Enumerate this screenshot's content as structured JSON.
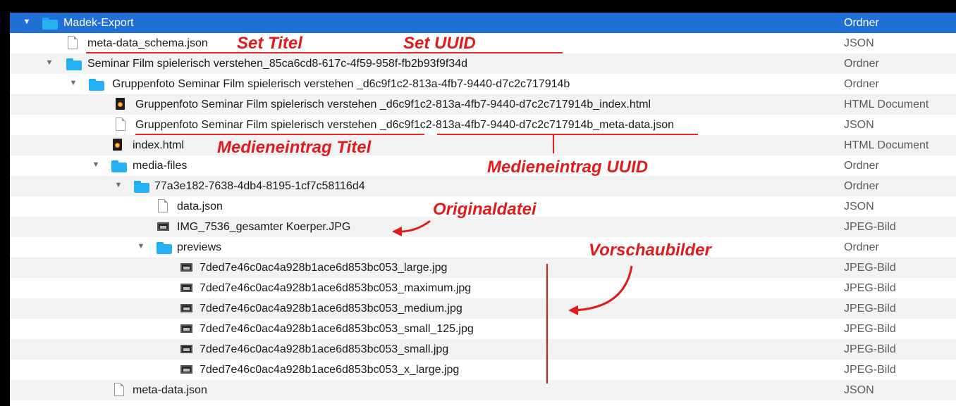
{
  "rows": [
    {
      "name": "Madek-Export",
      "kind": "Ordner",
      "icon": "folder-icon"
    },
    {
      "name": "meta-data_schema.json",
      "kind": "JSON",
      "icon": "document-icon"
    },
    {
      "name": "Seminar Film spielerisch verstehen_85ca6cd8-617c-4f59-958f-fb2b93f9f34d",
      "kind": "Ordner",
      "icon": "folder-icon"
    },
    {
      "name": "Gruppenfoto Seminar Film spielerisch verstehen _d6c9f1c2-813a-4fb7-9440-d7c2c717914b",
      "kind": "Ordner",
      "icon": "folder-icon"
    },
    {
      "name": "Gruppenfoto Seminar Film spielerisch verstehen _d6c9f1c2-813a-4fb7-9440-d7c2c717914b_index.html",
      "kind": "HTML Document",
      "icon": "html-file-icon"
    },
    {
      "name": "Gruppenfoto Seminar Film spielerisch verstehen _d6c9f1c2-813a-4fb7-9440-d7c2c717914b_meta-data.json",
      "kind": "JSON",
      "icon": "document-icon"
    },
    {
      "name": "index.html",
      "kind": "HTML Document",
      "icon": "html-file-icon"
    },
    {
      "name": "media-files",
      "kind": "Ordner",
      "icon": "folder-icon"
    },
    {
      "name": "77a3e182-7638-4db4-8195-1cf7c58116d4",
      "kind": "Ordner",
      "icon": "folder-icon"
    },
    {
      "name": "data.json",
      "kind": "JSON",
      "icon": "document-icon"
    },
    {
      "name": "IMG_7536_gesamter Koerper.JPG",
      "kind": "JPEG-Bild",
      "icon": "image-file-icon"
    },
    {
      "name": "previews",
      "kind": "Ordner",
      "icon": "folder-icon"
    },
    {
      "name": "7ded7e46c0ac4a928b1ace6d853bc053_large.jpg",
      "kind": "JPEG-Bild",
      "icon": "image-file-icon"
    },
    {
      "name": "7ded7e46c0ac4a928b1ace6d853bc053_maximum.jpg",
      "kind": "JPEG-Bild",
      "icon": "image-file-icon"
    },
    {
      "name": "7ded7e46c0ac4a928b1ace6d853bc053_medium.jpg",
      "kind": "JPEG-Bild",
      "icon": "image-file-icon"
    },
    {
      "name": "7ded7e46c0ac4a928b1ace6d853bc053_small_125.jpg",
      "kind": "JPEG-Bild",
      "icon": "image-file-icon"
    },
    {
      "name": "7ded7e46c0ac4a928b1ace6d853bc053_small.jpg",
      "kind": "JPEG-Bild",
      "icon": "image-file-icon"
    },
    {
      "name": "7ded7e46c0ac4a928b1ace6d853bc053_x_large.jpg",
      "kind": "JPEG-Bild",
      "icon": "image-file-icon"
    },
    {
      "name": "meta-data.json",
      "kind": "JSON",
      "icon": "document-icon"
    }
  ],
  "annotations": {
    "set_titel": "Set Titel",
    "set_uuid": "Set UUID",
    "medieneintrag_titel": "Medieneintrag Titel",
    "medieneintrag_uuid": "Medieneintrag UUID",
    "originaldatei": "Originaldatei",
    "vorschaubilder": "Vorschaubilder"
  },
  "colors": {
    "selection": "#1f6fd4",
    "annotation": "#e01b1b",
    "folder": "#27b1f5"
  }
}
